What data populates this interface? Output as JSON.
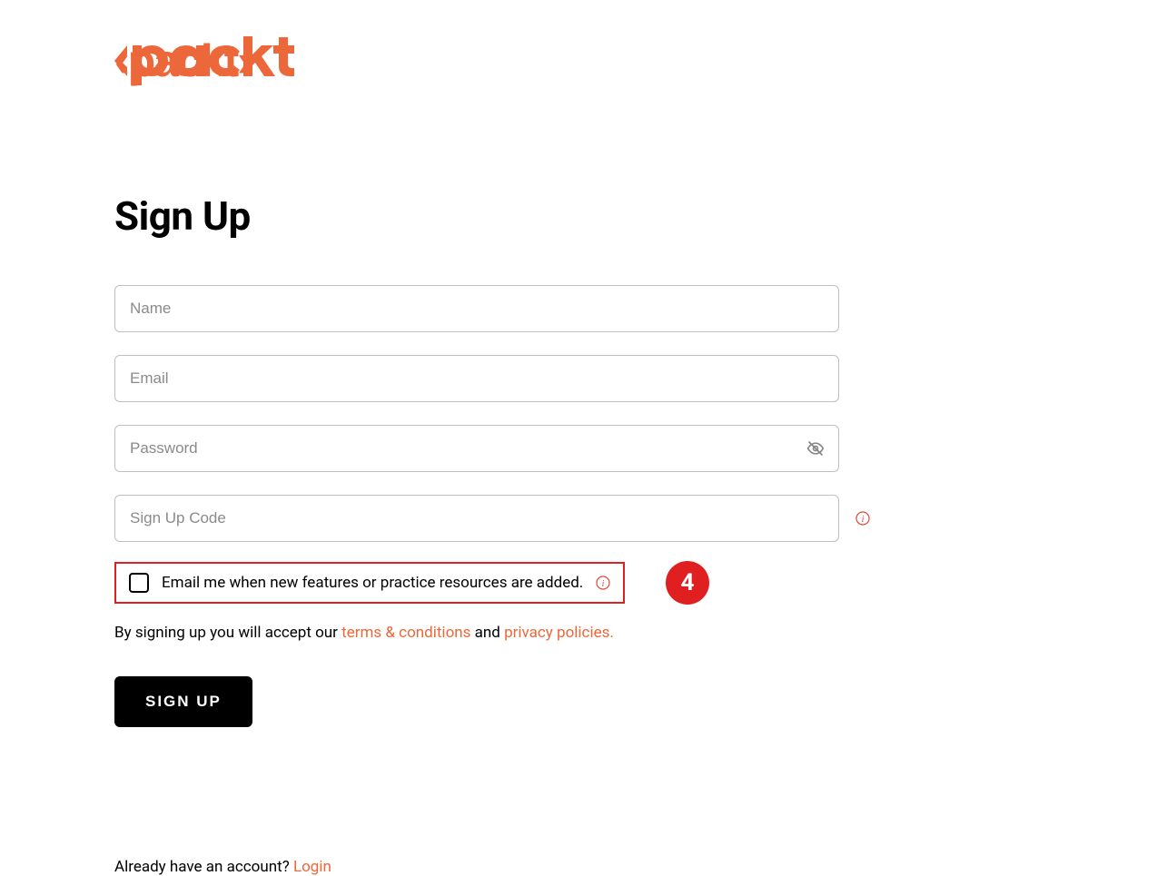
{
  "brand": {
    "name": "packt",
    "color": "#ec6739"
  },
  "heading": "Sign Up",
  "fields": {
    "name": {
      "placeholder": "Name",
      "value": ""
    },
    "email": {
      "placeholder": "Email",
      "value": ""
    },
    "password": {
      "placeholder": "Password",
      "value": ""
    },
    "signup_code": {
      "placeholder": "Sign Up Code",
      "value": ""
    }
  },
  "checkbox": {
    "label": "Email me when new features or practice resources are added.",
    "checked": false
  },
  "annotation": {
    "number": "4"
  },
  "terms": {
    "prefix": "By signing up you will accept our ",
    "terms_link": "terms & conditions",
    "middle": " and ",
    "privacy_link": "privacy policies."
  },
  "submit_button": "SIGN UP",
  "login_prompt": {
    "text": "Already have an account? ",
    "link": "Login"
  }
}
